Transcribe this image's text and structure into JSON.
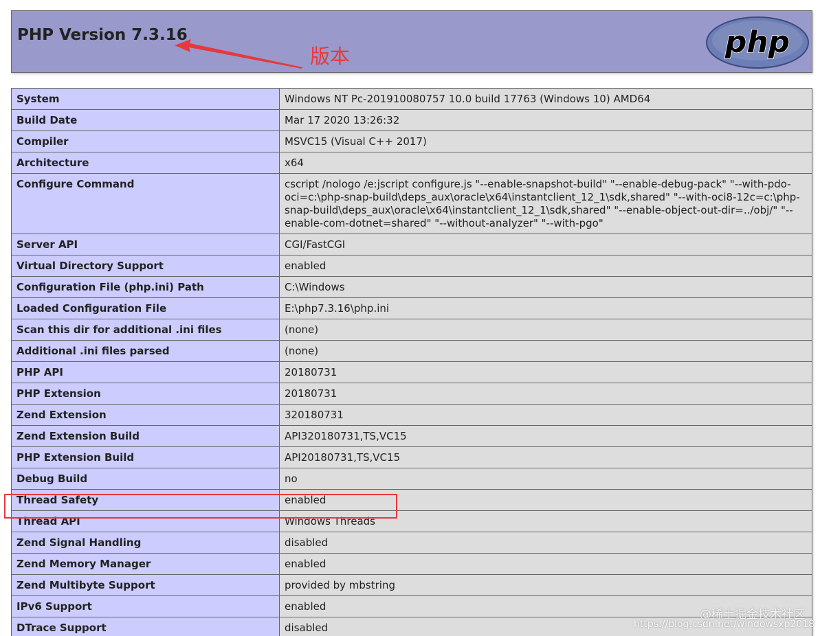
{
  "header": {
    "title": "PHP Version 7.3.16",
    "logo_text": "php"
  },
  "annotations": {
    "version_label": "版本",
    "color": "#e5393b"
  },
  "rows": [
    {
      "key": "System",
      "value": "Windows NT Pc-201910080757 10.0 build 17763 (Windows 10) AMD64"
    },
    {
      "key": "Build Date",
      "value": "Mar 17 2020 13:26:32"
    },
    {
      "key": "Compiler",
      "value": "MSVC15 (Visual C++ 2017)"
    },
    {
      "key": "Architecture",
      "value": "x64"
    },
    {
      "key": "Configure Command",
      "value": "cscript /nologo /e:jscript configure.js \"--enable-snapshot-build\" \"--enable-debug-pack\" \"--with-pdo-oci=c:\\php-snap-build\\deps_aux\\oracle\\x64\\instantclient_12_1\\sdk,shared\" \"--with-oci8-12c=c:\\php-snap-build\\deps_aux\\oracle\\x64\\instantclient_12_1\\sdk,shared\" \"--enable-object-out-dir=../obj/\" \"--enable-com-dotnet=shared\" \"--without-analyzer\" \"--with-pgo\""
    },
    {
      "key": "Server API",
      "value": "CGI/FastCGI"
    },
    {
      "key": "Virtual Directory Support",
      "value": "enabled"
    },
    {
      "key": "Configuration File (php.ini) Path",
      "value": "C:\\Windows"
    },
    {
      "key": "Loaded Configuration File",
      "value": "E:\\php7.3.16\\php.ini"
    },
    {
      "key": "Scan this dir for additional .ini files",
      "value": "(none)"
    },
    {
      "key": "Additional .ini files parsed",
      "value": "(none)"
    },
    {
      "key": "PHP API",
      "value": "20180731"
    },
    {
      "key": "PHP Extension",
      "value": "20180731"
    },
    {
      "key": "Zend Extension",
      "value": "320180731"
    },
    {
      "key": "Zend Extension Build",
      "value": "API320180731,TS,VC15"
    },
    {
      "key": "PHP Extension Build",
      "value": "API20180731,TS,VC15"
    },
    {
      "key": "Debug Build",
      "value": "no"
    },
    {
      "key": "Thread Safety",
      "value": "enabled"
    },
    {
      "key": "Thread API",
      "value": "Windows Threads"
    },
    {
      "key": "Zend Signal Handling",
      "value": "disabled"
    },
    {
      "key": "Zend Memory Manager",
      "value": "enabled"
    },
    {
      "key": "Zend Multibyte Support",
      "value": "provided by mbstring"
    },
    {
      "key": "IPv6 Support",
      "value": "enabled"
    },
    {
      "key": "DTrace Support",
      "value": "disabled"
    }
  ],
  "watermark": {
    "site": "@稀土掘金技术社区",
    "url": "https://blog.csdn.net/windowsxp2018"
  }
}
